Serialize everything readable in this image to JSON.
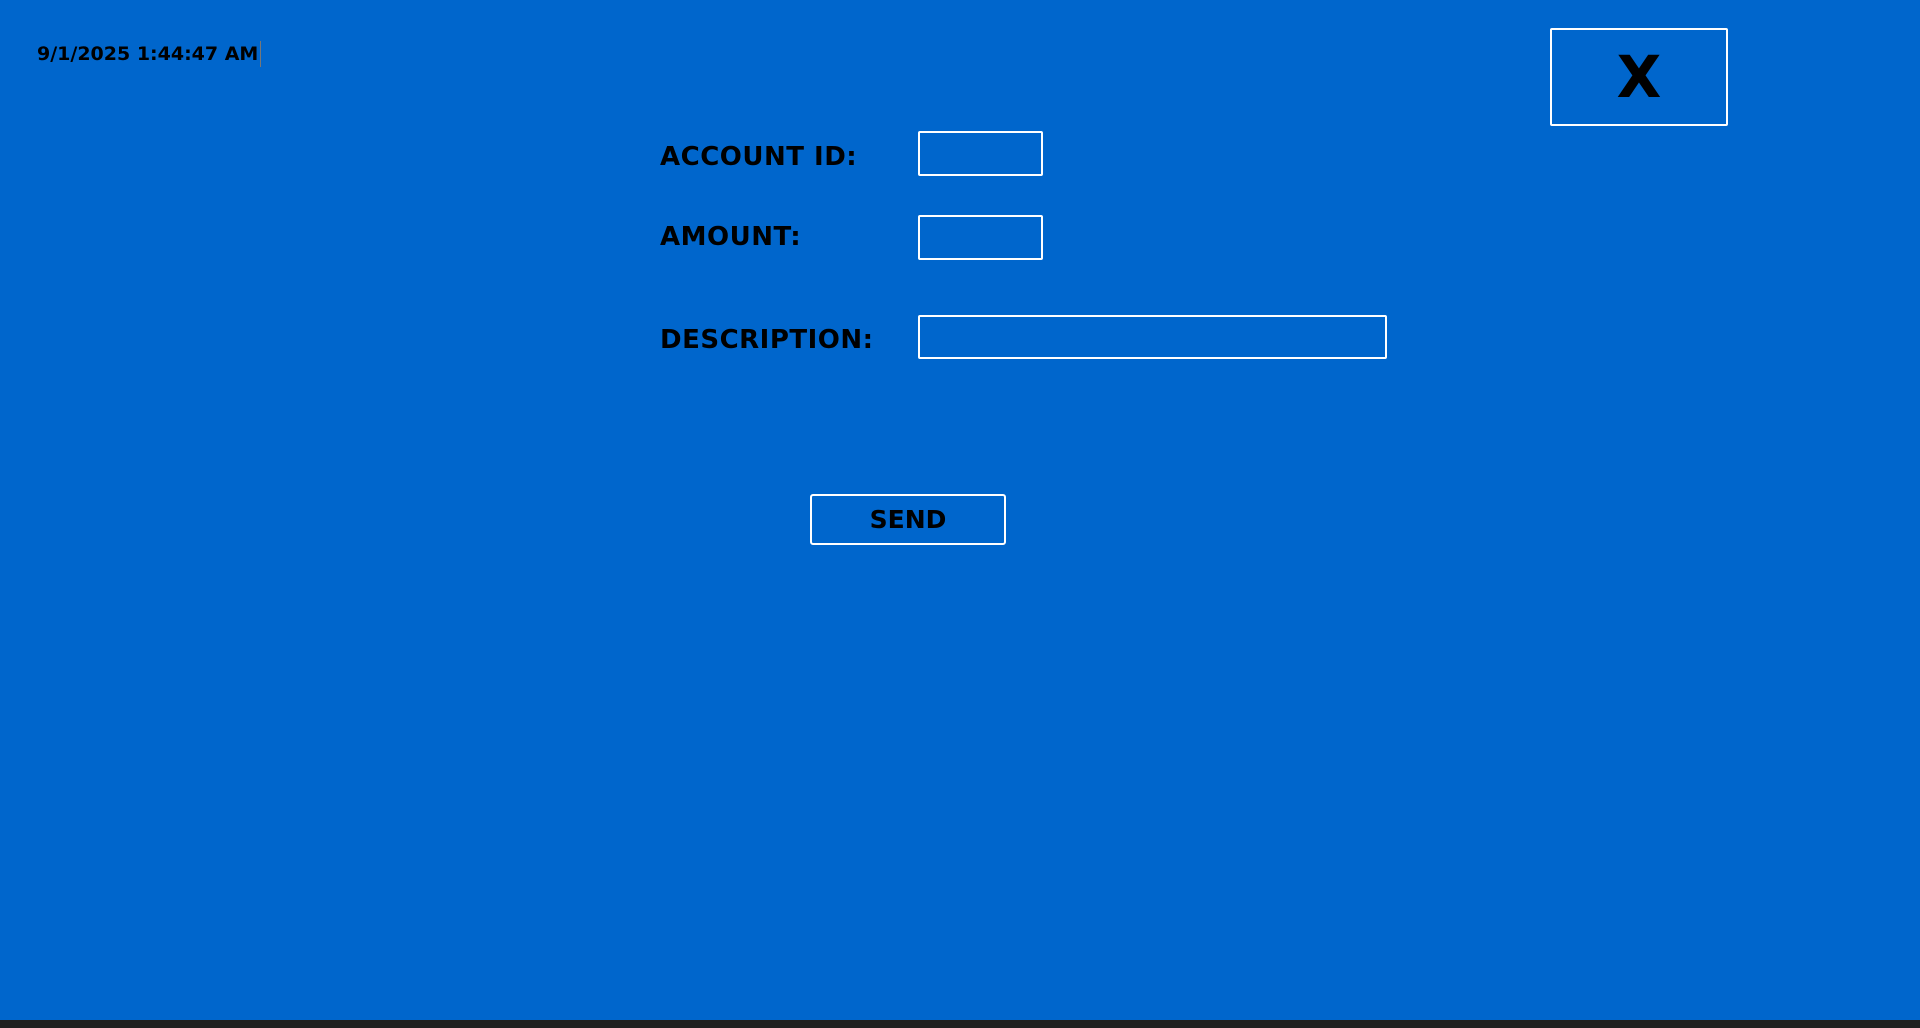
{
  "header": {
    "timestamp": "9/1/2025 1:44:47 AM",
    "close_label": "X"
  },
  "form": {
    "account_id_label": "ACCOUNT ID:",
    "account_id_value": "",
    "amount_label": "AMOUNT:",
    "amount_value": "",
    "description_label": "DESCRIPTION:",
    "description_value": "",
    "send_label": "SEND"
  },
  "colors": {
    "background": "#0066CC",
    "border": "#FFFFFF",
    "text": "#000000"
  }
}
